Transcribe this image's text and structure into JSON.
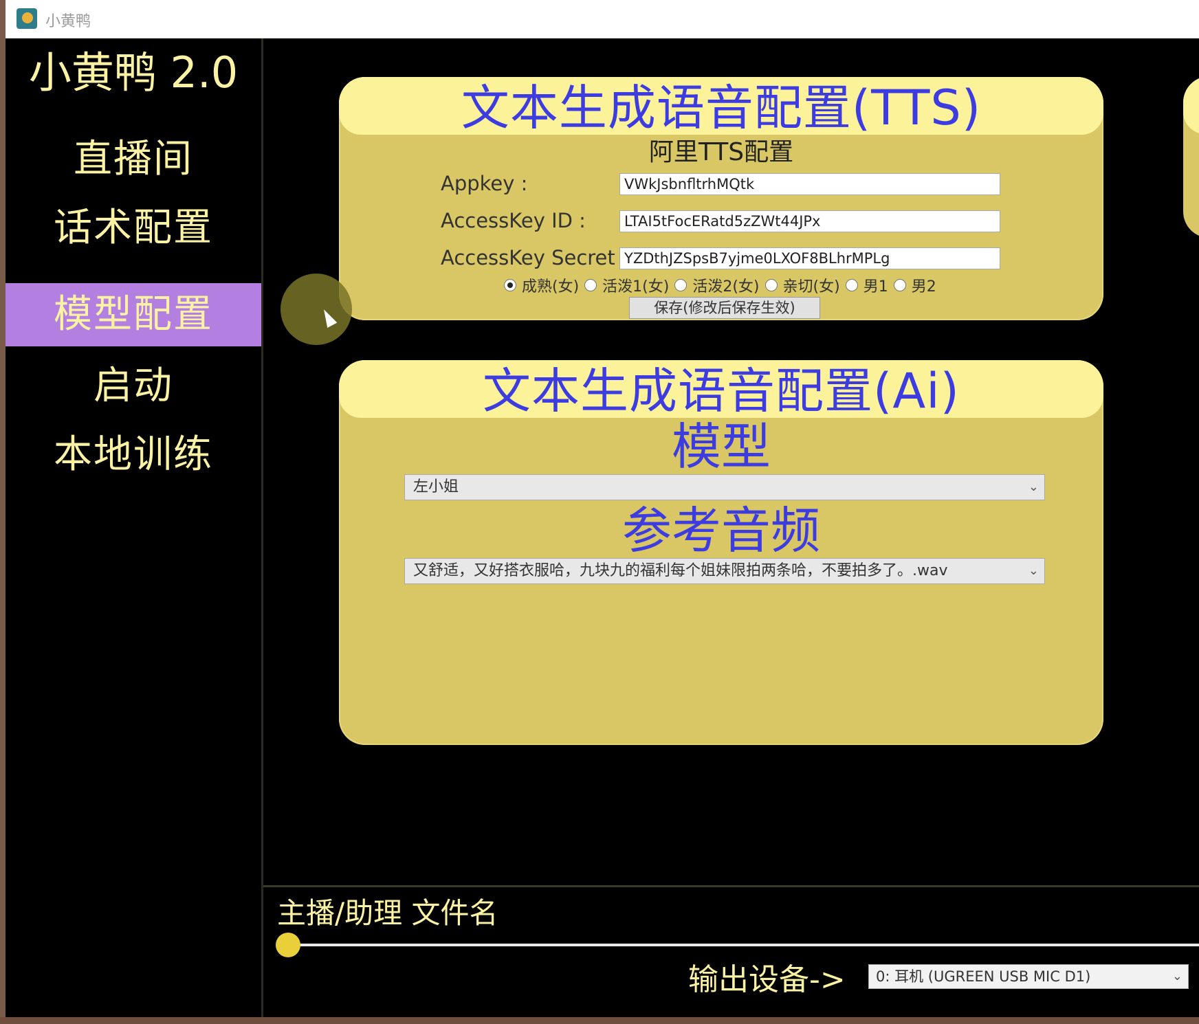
{
  "window": {
    "title": "小黄鸭"
  },
  "sidebar": {
    "brand": "小黄鸭 2.0",
    "items": [
      {
        "label": "直播间"
      },
      {
        "label": "话术配置"
      },
      {
        "label": "模型配置",
        "active": true
      },
      {
        "label": "启动"
      },
      {
        "label": "本地训练"
      }
    ]
  },
  "tts_panel": {
    "title": "文本生成语音配置(TTS)",
    "subtitle": "阿里TTS配置",
    "fields": [
      {
        "label": "Appkey :",
        "value": "VWkJsbnfltrhMQtk"
      },
      {
        "label": "AccessKey ID :",
        "value": "LTAI5tFocERatd5zZWt44JPx"
      },
      {
        "label": "AccessKey Secret :",
        "value": "YZDthJZSpsB7yjme0LXOF8BLhrMPLg"
      }
    ],
    "voices": [
      {
        "label": "成熟(女)",
        "checked": true
      },
      {
        "label": "活泼1(女)",
        "checked": false
      },
      {
        "label": "活泼2(女)",
        "checked": false
      },
      {
        "label": "亲切(女)",
        "checked": false
      },
      {
        "label": "男1",
        "checked": false
      },
      {
        "label": "男2",
        "checked": false
      }
    ],
    "save_label": "保存(修改后保存生效)"
  },
  "ai_panel": {
    "title": "文本生成语音配置(Ai)",
    "model_label": "模型",
    "model_value": "左小姐",
    "ref_audio_label": "参考音频",
    "ref_audio_value": "又舒适，又好搭衣服哈，九块九的福利每个姐妹限拍两条哈，不要拍多了。.wav"
  },
  "player": {
    "title": "主播/助理 文件名",
    "progress": 0,
    "output_label": "输出设备->",
    "output_value": "0: 耳机 (UGREEN USB MIC D1)"
  },
  "colors": {
    "accent_blue": "#3c3ce0",
    "panel_yellow": "#d9c765",
    "panel_head": "#fcf29a",
    "nav_active": "#b37fe0",
    "nav_text": "#fbf3a3"
  }
}
